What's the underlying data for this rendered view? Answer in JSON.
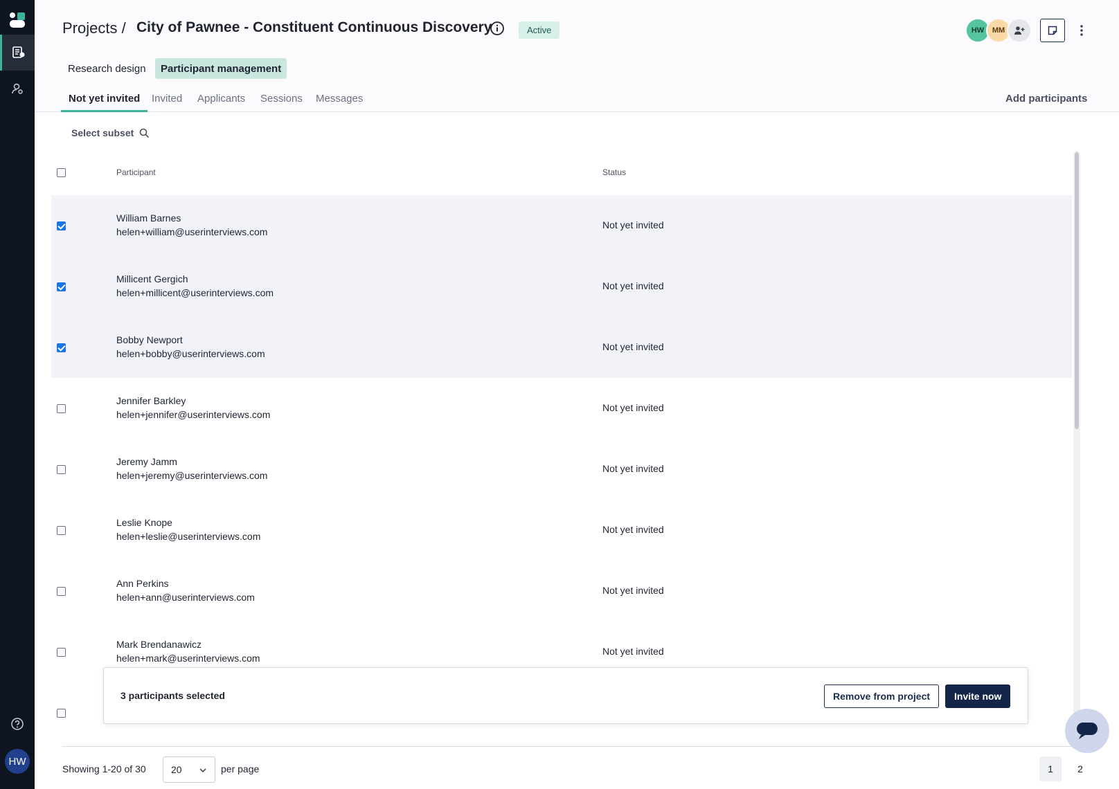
{
  "header": {
    "breadcrumb": "Projects /",
    "title": "City of Pawnee - Constituent Continuous Discovery",
    "status_badge": "Active",
    "avatars": [
      {
        "initials": "HW",
        "color": "#55c59e"
      },
      {
        "initials": "MM",
        "color": "#fbd9a6"
      }
    ]
  },
  "mode_tabs": [
    {
      "label": "Research design",
      "active": false
    },
    {
      "label": "Participant management",
      "active": true
    }
  ],
  "sub_tabs": [
    {
      "label": "Not yet invited",
      "active": true
    },
    {
      "label": "Invited",
      "active": false
    },
    {
      "label": "Applicants",
      "active": false
    },
    {
      "label": "Sessions",
      "active": false
    },
    {
      "label": "Messages",
      "active": false
    }
  ],
  "add_participants_label": "Add participants",
  "select_subset_label": "Select subset",
  "table": {
    "columns": [
      "Participant",
      "Status"
    ],
    "rows": [
      {
        "name": "William Barnes",
        "email": "helen+william@userinterviews.com",
        "status": "Not yet invited",
        "checked": true
      },
      {
        "name": "Millicent Gergich",
        "email": "helen+millicent@userinterviews.com",
        "status": "Not yet invited",
        "checked": true
      },
      {
        "name": "Bobby Newport",
        "email": "helen+bobby@userinterviews.com",
        "status": "Not yet invited",
        "checked": true
      },
      {
        "name": "Jennifer Barkley",
        "email": "helen+jennifer@userinterviews.com",
        "status": "Not yet invited",
        "checked": false
      },
      {
        "name": "Jeremy Jamm",
        "email": "helen+jeremy@userinterviews.com",
        "status": "Not yet invited",
        "checked": false
      },
      {
        "name": "Leslie Knope",
        "email": "helen+leslie@userinterviews.com",
        "status": "Not yet invited",
        "checked": false
      },
      {
        "name": "Ann Perkins",
        "email": "helen+ann@userinterviews.com",
        "status": "Not yet invited",
        "checked": false
      },
      {
        "name": "Mark Brendanawicz",
        "email": "helen+mark@userinterviews.com",
        "status": "Not yet invited",
        "checked": false
      }
    ]
  },
  "selection_bar": {
    "count_label": "3 participants selected",
    "remove_label": "Remove from project",
    "invite_label": "Invite now"
  },
  "footer": {
    "showing": "Showing 1-20 of 30",
    "per_page_value": "20",
    "per_page_label": "per page",
    "pages": [
      "1",
      "2"
    ],
    "current_page": "1"
  },
  "user": {
    "initials": "HW"
  },
  "colors": {
    "accent": "#3bb39b",
    "primary": "#14254a",
    "rail": "#0e1420",
    "checkbox": "#1a73e8"
  }
}
